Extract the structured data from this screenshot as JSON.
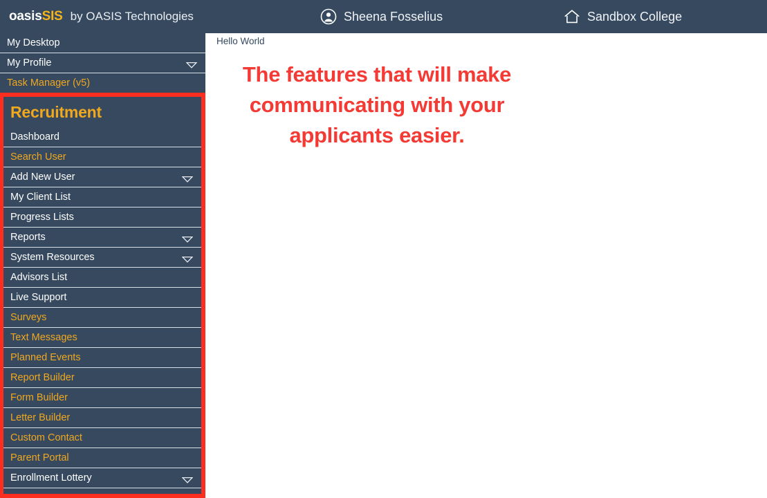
{
  "header": {
    "brand_primary": "oasis",
    "brand_accent": "SIS",
    "brand_tagline": "by OASIS Technologies",
    "user_name": "Sheena Fosselius",
    "user_icon": "user-circle-icon",
    "school_name": "Sandbox College",
    "school_icon": "home-icon",
    "background_color": "#36495f",
    "accent_color": "#f5b31c"
  },
  "sidebar": {
    "background_color": "#36495f",
    "highlight_color": "#fd2e20",
    "gold_color": "#f0a81e",
    "top_items": [
      {
        "label": "My Desktop",
        "gold": false,
        "chevron": false
      },
      {
        "label": "My Profile",
        "gold": false,
        "chevron": true
      },
      {
        "label": "Task Manager (v5)",
        "gold": true,
        "chevron": false
      }
    ],
    "section": {
      "heading": "Recruitment",
      "items": [
        {
          "label": "Dashboard",
          "gold": false,
          "chevron": false
        },
        {
          "label": "Search User",
          "gold": true,
          "chevron": false
        },
        {
          "label": "Add New User",
          "gold": false,
          "chevron": true
        },
        {
          "label": "My Client List",
          "gold": false,
          "chevron": false
        },
        {
          "label": "Progress Lists",
          "gold": false,
          "chevron": false
        },
        {
          "label": "Reports",
          "gold": false,
          "chevron": true
        },
        {
          "label": "System Resources",
          "gold": false,
          "chevron": true
        },
        {
          "label": "Advisors List",
          "gold": false,
          "chevron": false
        },
        {
          "label": "Live Support",
          "gold": false,
          "chevron": false
        },
        {
          "label": "Surveys",
          "gold": true,
          "chevron": false
        },
        {
          "label": "Text Messages",
          "gold": true,
          "chevron": false
        },
        {
          "label": "Planned Events",
          "gold": true,
          "chevron": false
        },
        {
          "label": "Report Builder",
          "gold": true,
          "chevron": false
        },
        {
          "label": "Form Builder",
          "gold": true,
          "chevron": false
        },
        {
          "label": "Letter Builder",
          "gold": true,
          "chevron": false
        },
        {
          "label": "Custom Contact",
          "gold": true,
          "chevron": false
        },
        {
          "label": "Parent Portal",
          "gold": true,
          "chevron": false
        },
        {
          "label": "Enrollment Lottery",
          "gold": false,
          "chevron": true
        }
      ]
    }
  },
  "main": {
    "breadcrumb": "Hello World",
    "headline": "The features that will make communicating with your applicants easier.",
    "headline_color": "#f43a35"
  }
}
